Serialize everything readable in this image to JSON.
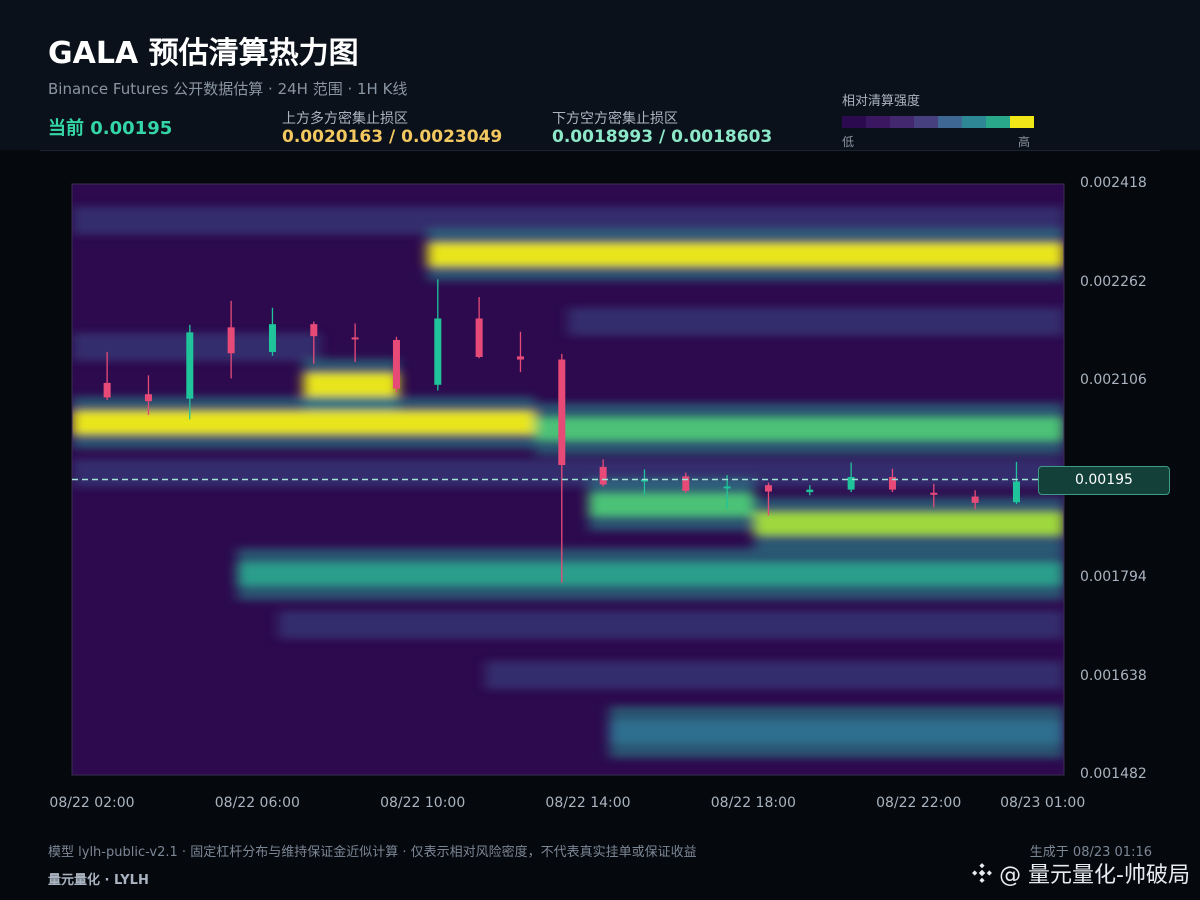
{
  "header": {
    "title": "GALA 预估清算热力图",
    "subtitle": "Binance Futures 公开数据估算 · 24H 范围 · 1H K线",
    "current_label": "当前 0.00195",
    "upper_zone_label": "上方多方密集止损区",
    "upper_zone_value": "0.0020163 / 0.0023049",
    "lower_zone_label": "下方空方密集止损区",
    "lower_zone_value": "0.0018993 / 0.0018603"
  },
  "legend": {
    "title": "相对清算强度",
    "low": "低",
    "high": "高",
    "colors": [
      "#2b0a4f",
      "#3a1760",
      "#43286f",
      "#46407e",
      "#3f6794",
      "#2e8795",
      "#2aa98a",
      "#f1e617"
    ]
  },
  "colors": {
    "up_candle": "#1fc49a",
    "down_candle": "#e84a78",
    "current_line": "#9fe3d6",
    "upper_zone": "#f3c861",
    "lower_zone": "#8ce8c8"
  },
  "price_tag": "0.00195",
  "footer": {
    "model_note": "模型 lylh-public-v2.1 · 固定杠杆分布与维持保证金近似计算 · 仅表示相对风险密度，不代表真实挂单或保证收益",
    "brand": "量元量化 · LYLH",
    "generated": "生成于 08/23 01:16",
    "watermark": "@ 量元量化-帅破局"
  },
  "chart_data": {
    "type": "heatmap",
    "title": "GALA 预估清算热力图",
    "y_ticks": [
      "0.002418",
      "0.002262",
      "0.002106",
      "0.001794",
      "0.001638",
      "0.001482"
    ],
    "ylim": [
      0.001482,
      0.002418
    ],
    "x_ticks": [
      "08/22 02:00",
      "08/22 06:00",
      "08/22 10:00",
      "08/22 14:00",
      "08/22 18:00",
      "08/22 22:00",
      "08/23 01:00"
    ],
    "current_price": 0.00195,
    "heat_bands": [
      {
        "price": 0.002306,
        "from_hour": 8.6,
        "to_hour": 24,
        "intensity": 1.0
      },
      {
        "price": 0.00204,
        "from_hour": 0,
        "to_hour": 11.2,
        "intensity": 0.9
      },
      {
        "price": 0.00203,
        "from_hour": 11.2,
        "to_hour": 24,
        "intensity": 0.65
      },
      {
        "price": 0.0021,
        "from_hour": 5.6,
        "to_hour": 7.9,
        "intensity": 0.95
      },
      {
        "price": 0.00188,
        "from_hour": 16.5,
        "to_hour": 24,
        "intensity": 0.85
      },
      {
        "price": 0.00191,
        "from_hour": 12.5,
        "to_hour": 16.5,
        "intensity": 0.6
      },
      {
        "price": 0.0018,
        "from_hour": 4,
        "to_hour": 24,
        "intensity": 0.5
      },
      {
        "price": 0.00155,
        "from_hour": 13,
        "to_hour": 24,
        "intensity": 0.35
      }
    ],
    "candles": [
      {
        "time": "02:00",
        "open": 0.002103,
        "close": 0.00208,
        "high": 0.002152,
        "low": 0.002076
      },
      {
        "time": "03:00",
        "open": 0.002085,
        "close": 0.002074,
        "high": 0.002115,
        "low": 0.002052
      },
      {
        "time": "04:00",
        "open": 0.002078,
        "close": 0.002183,
        "high": 0.002195,
        "low": 0.002045
      },
      {
        "time": "05:00",
        "open": 0.002191,
        "close": 0.00215,
        "high": 0.002233,
        "low": 0.00211
      },
      {
        "time": "06:00",
        "open": 0.002152,
        "close": 0.002196,
        "high": 0.002222,
        "low": 0.002146
      },
      {
        "time": "07:00",
        "open": 0.002196,
        "close": 0.002177,
        "high": 0.0022,
        "low": 0.002133
      },
      {
        "time": "08:00",
        "open": 0.002175,
        "close": 0.002172,
        "high": 0.002197,
        "low": 0.002136
      },
      {
        "time": "09:00",
        "open": 0.002171,
        "close": 0.002094,
        "high": 0.002176,
        "low": 0.002088
      },
      {
        "time": "10:00",
        "open": 0.0021,
        "close": 0.002205,
        "high": 0.002267,
        "low": 0.002091
      },
      {
        "time": "11:00",
        "open": 0.002205,
        "close": 0.002144,
        "high": 0.002239,
        "low": 0.002142
      },
      {
        "time": "12:00",
        "open": 0.002145,
        "close": 0.00214,
        "high": 0.002184,
        "low": 0.00212
      },
      {
        "time": "13:00",
        "open": 0.00214,
        "close": 0.001973,
        "high": 0.002149,
        "low": 0.001786
      },
      {
        "time": "14:00",
        "open": 0.00197,
        "close": 0.001942,
        "high": 0.001982,
        "low": 0.001939
      },
      {
        "time": "15:00",
        "open": 0.001948,
        "close": 0.00195,
        "high": 0.001966,
        "low": 0.001926
      },
      {
        "time": "16:00",
        "open": 0.001955,
        "close": 0.001932,
        "high": 0.001961,
        "low": 0.001929
      },
      {
        "time": "17:00",
        "open": 0.001939,
        "close": 0.001939,
        "high": 0.001957,
        "low": 0.001904
      },
      {
        "time": "18:00",
        "open": 0.001941,
        "close": 0.001931,
        "high": 0.001945,
        "low": 0.001893
      },
      {
        "time": "19:00",
        "open": 0.00193,
        "close": 0.001934,
        "high": 0.001941,
        "low": 0.001925
      },
      {
        "time": "20:00",
        "open": 0.001934,
        "close": 0.001954,
        "high": 0.001977,
        "low": 0.00193
      },
      {
        "time": "21:00",
        "open": 0.001954,
        "close": 0.001934,
        "high": 0.001967,
        "low": 0.00193
      },
      {
        "time": "22:00",
        "open": 0.001929,
        "close": 0.001927,
        "high": 0.001943,
        "low": 0.001906
      },
      {
        "time": "23:00",
        "open": 0.001923,
        "close": 0.001913,
        "high": 0.001933,
        "low": 0.001903
      },
      {
        "time": "00:00",
        "open": 0.001914,
        "close": 0.001947,
        "high": 0.001978,
        "low": 0.001911
      }
    ]
  }
}
